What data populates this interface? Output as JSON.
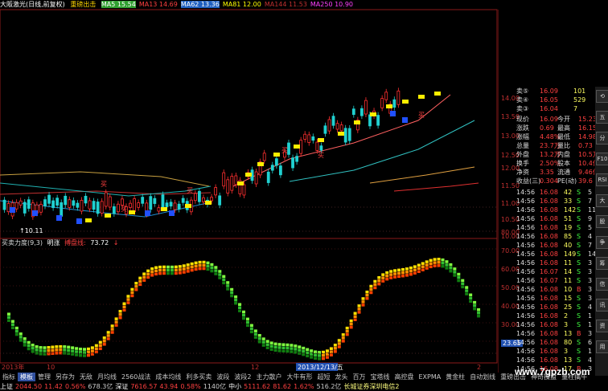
{
  "legend": {
    "title": "大阪激光(日线,前复权)",
    "indicator": "重磅出击",
    "items": [
      {
        "label": "MA5 15.54",
        "color": "#ffffff",
        "bg": "#30a030"
      },
      {
        "label": "MA13 14.69",
        "color": "#ff4040",
        "bg": ""
      },
      {
        "label": "MA62 13.36",
        "color": "#ffffff",
        "bg": "#2060c0"
      },
      {
        "label": "MA81 12.00",
        "color": "#ffff00",
        "bg": ""
      },
      {
        "label": "MA144 11.53",
        "color": "#c03030",
        "bg": ""
      },
      {
        "label": "MA250 10.90",
        "color": "#ff40ff",
        "bg": ""
      }
    ]
  },
  "price_axis": [
    "14.00",
    "13.50",
    "13.00",
    "12.50",
    "12.00",
    "11.50",
    "11.00",
    "10.50",
    "10.00"
  ],
  "low_marker": "10.11",
  "buy_label": "买",
  "indicator": {
    "name": "买卖力度(9,3)",
    "label1": "明涨",
    "label2": "搏盘线:",
    "value": "73.72",
    "arrow": "↓",
    "axis": [
      "80.00",
      "70.00",
      "60.00",
      "50.00",
      "40.00",
      "30.00"
    ],
    "cur_value": "23.65"
  },
  "date_axis": {
    "month1": "2013年",
    "day1": "10",
    "mark2": "12",
    "highlight": "2013/12/13/五",
    "end": "2"
  },
  "quote": {
    "orders": [
      {
        "label": "卖⑤",
        "price": "16.09",
        "vol": "101"
      },
      {
        "label": "卖④",
        "price": "16.05",
        "vol": "529"
      },
      {
        "label": "卖③",
        "price": "16.04",
        "vol": "7"
      }
    ],
    "stats": [
      {
        "l1": "现价",
        "v1": "16.09",
        "l2": "今开",
        "v2": "15.23"
      },
      {
        "l1": "涨跌",
        "v1": "0.69",
        "l2": "最高",
        "v2": "16.15"
      },
      {
        "l1": "涨幅",
        "v1": "4.48%",
        "l2": "最低",
        "v2": "14.98"
      },
      {
        "l1": "总量",
        "v1": "23.7万",
        "l2": "量比",
        "v2": "0.73"
      },
      {
        "l1": "外盘",
        "v1": "13.2万",
        "l2": "内盘",
        "v2": "10.5万"
      },
      {
        "l1": "换手",
        "v1": "2.50%",
        "l2": "股本",
        "v2": "10.4亿"
      },
      {
        "l1": "净资",
        "v1": "3.35",
        "l2": "流通",
        "v2": "9.46亿"
      },
      {
        "l1": "收益(三)",
        "v1": "0.304",
        "l2": "PE(动)",
        "v2": "39.6"
      }
    ],
    "ticks": [
      {
        "t": "14:56",
        "p": "16.08",
        "v": "42",
        "d": "S",
        "n": "5"
      },
      {
        "t": "14:56",
        "p": "16.08",
        "v": "33",
        "d": "S",
        "n": "7"
      },
      {
        "t": "14:56",
        "p": "16.08",
        "v": "142",
        "d": "S",
        "n": "11"
      },
      {
        "t": "14:56",
        "p": "16.08",
        "v": "51",
        "d": "S",
        "n": "9"
      },
      {
        "t": "14:56",
        "p": "16.08",
        "v": "19",
        "d": "S",
        "n": "5"
      },
      {
        "t": "14:56",
        "p": "16.08",
        "v": "85",
        "d": "S",
        "n": "4"
      },
      {
        "t": "14:56",
        "p": "16.08",
        "v": "40",
        "d": "S",
        "n": "7"
      },
      {
        "t": "14:56",
        "p": "16.08",
        "v": "149",
        "d": "S",
        "n": "14"
      },
      {
        "t": "14:56",
        "p": "16.08",
        "v": "11",
        "d": "S",
        "n": "3"
      },
      {
        "t": "14:56",
        "p": "16.07",
        "v": "14",
        "d": "S",
        "n": "3"
      },
      {
        "t": "14:56",
        "p": "16.07",
        "v": "11",
        "d": "S",
        "n": "3"
      },
      {
        "t": "14:56",
        "p": "16.08",
        "v": "10",
        "d": "B",
        "n": "3"
      },
      {
        "t": "14:56",
        "p": "16.08",
        "v": "15",
        "d": "S",
        "n": "3"
      },
      {
        "t": "14:56",
        "p": "16.08",
        "v": "25",
        "d": "S",
        "n": "4"
      },
      {
        "t": "14:56",
        "p": "16.08",
        "v": "2",
        "d": "S",
        "n": "1"
      },
      {
        "t": "14:56",
        "p": "16.08",
        "v": "3",
        "d": "S",
        "n": "1"
      },
      {
        "t": "14:56",
        "p": "16.08",
        "v": "13",
        "d": "B",
        "n": "3"
      },
      {
        "t": "14:56",
        "p": "16.08",
        "v": "80",
        "d": "S",
        "n": "6"
      },
      {
        "t": "14:56",
        "p": "16.08",
        "v": "3",
        "d": "S",
        "n": "1"
      },
      {
        "t": "14:56",
        "p": "16.08",
        "v": "13",
        "d": "S",
        "n": "4"
      },
      {
        "t": "14:56",
        "p": "16.08",
        "v": "17",
        "d": "B",
        "n": "3"
      },
      {
        "t": "14:56",
        "p": "16.08",
        "v": "38",
        "d": "S",
        "n": "6"
      },
      {
        "t": "14:56",
        "p": "16.08",
        "v": "13",
        "d": "S",
        "n": "4"
      }
    ]
  },
  "toolbar": [
    "指标",
    "模板",
    "管理",
    "另存为",
    "无敌",
    "月均线",
    "2560战法",
    "成本均线",
    "利多买卖",
    "波段",
    "波段2",
    "主力散户",
    "大牛有形",
    "超短",
    "龙头",
    "百万",
    "宝塔线",
    "高控盘",
    "EXPMA",
    "黄金柱",
    "自动划线",
    "重磅出击",
    "神奇操盘",
    "量柱擒牛"
  ],
  "toolbar_active": 1,
  "status": [
    {
      "t": "上证",
      "c": "#ffffff"
    },
    {
      "t": "2044.50",
      "c": "#ff4040"
    },
    {
      "t": "11.42",
      "c": "#ff4040"
    },
    {
      "t": "0.56%",
      "c": "#ff4040"
    },
    {
      "t": "678.3亿",
      "c": "#cccccc"
    },
    {
      "t": "深证",
      "c": "#ffffff"
    },
    {
      "t": "7616.57",
      "c": "#ff4040"
    },
    {
      "t": "43.94",
      "c": "#ff4040"
    },
    {
      "t": "0.58%",
      "c": "#ff4040"
    },
    {
      "t": "1140亿",
      "c": "#cccccc"
    },
    {
      "t": "中小",
      "c": "#ffffff"
    },
    {
      "t": "5111.62",
      "c": "#ff4040"
    },
    {
      "t": "81.62",
      "c": "#ff4040"
    },
    {
      "t": "1.62%",
      "c": "#ff4040"
    },
    {
      "t": "516.2亿",
      "c": "#cccccc"
    },
    {
      "t": "长城证券深圳电信2",
      "c": "#ffff80"
    }
  ],
  "watermark": "www.7gpzb.com",
  "side_icons": [
    "⟲",
    "五",
    "分",
    "F10",
    "RSI",
    "大",
    "股",
    "争",
    "筹",
    "信",
    "讯",
    "资",
    "用"
  ]
}
